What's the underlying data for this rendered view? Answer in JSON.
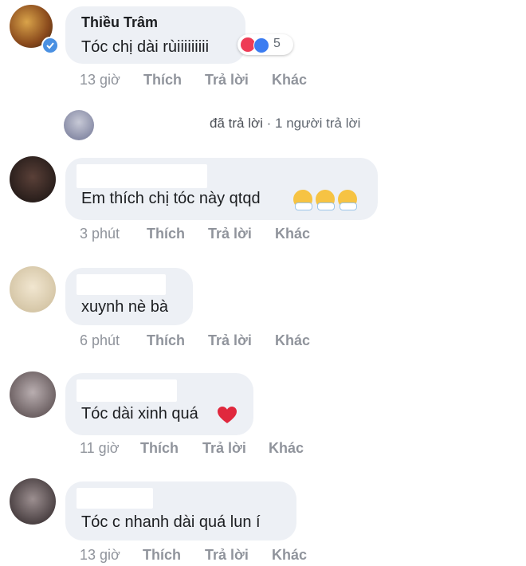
{
  "comments": [
    {
      "author": "Thiều Trâm",
      "text": "Tóc chị dài rùiiiiiiiii",
      "reaction_count": "5",
      "time": "13 giờ",
      "actions": [
        "Thích",
        "Trả lời",
        "Khác"
      ]
    },
    {
      "text": "Em thích chị tóc này qtqd",
      "time": "3 phút",
      "actions": [
        "Thích",
        "Trả lời",
        "Khác"
      ]
    },
    {
      "text": "xuynh nè bà",
      "time": "6 phút",
      "actions": [
        "Thích",
        "Trả lời",
        "Khác"
      ]
    },
    {
      "text": "Tóc dài xinh quá",
      "time": "11 giờ",
      "actions": [
        "Thích",
        "Trả lời",
        "Khác"
      ]
    },
    {
      "text": "Tóc c nhanh dài quá lun í",
      "time": "13 giờ",
      "actions": [
        "Thích",
        "Trả lời",
        "Khác"
      ]
    }
  ],
  "reply_summary": {
    "replied": "đã trả lời",
    "separator": "·",
    "count": "1 người trả lời"
  },
  "colors": {
    "bubble": "#edf0f5",
    "meta_text": "#90949c",
    "heart": "#ee3b55",
    "like": "#3b7cf1"
  },
  "icons": [
    "verified-badge-icon",
    "heart-reaction-icon",
    "like-reaction-icon",
    "blush-emoji-icon",
    "red-heart-emoji-icon"
  ]
}
